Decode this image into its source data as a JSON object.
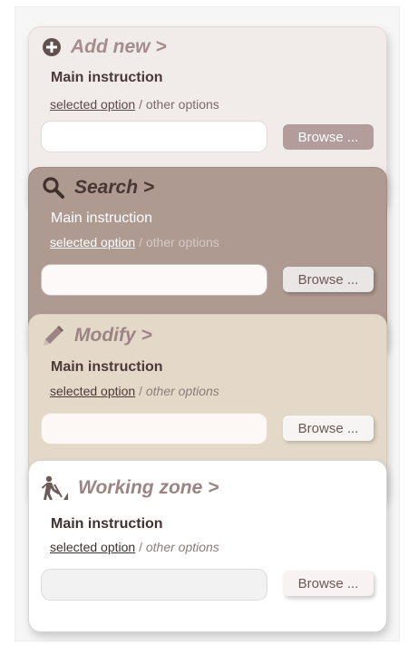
{
  "panels": {
    "add_new": {
      "title": "Add new >",
      "icon": "plus-circle-icon",
      "instruction": "Main instruction",
      "selected_option": "selected option",
      "other_options": " / other options",
      "input_value": "",
      "browse_label": "Browse ..."
    },
    "search": {
      "title": "Search >",
      "icon": "magnifier-icon",
      "instruction": "Main instruction",
      "selected_option": "selected option",
      "other_options": " / other options",
      "input_value": "",
      "browse_label": "Browse ..."
    },
    "modify": {
      "title": "Modify >",
      "icon": "pencil-icon",
      "instruction": "Main instruction",
      "selected_option": "selected option",
      "other_options": "other options",
      "separator": " / ",
      "input_value": "",
      "browse_label": "Browse ..."
    },
    "working_zone": {
      "title": "Working zone >",
      "icon": "construction-worker-icon",
      "instruction": "Main instruction",
      "selected_option": "selected option",
      "other_options": "other options",
      "separator": " / ",
      "input_value": "",
      "browse_label": "Browse ..."
    }
  },
  "colors": {
    "add_new_bg": "#f1ebea",
    "search_bg": "#ae9a91",
    "modify_bg": "#e4d9c8",
    "working_zone_bg": "#ffffff",
    "title_accent": "#a58d8d"
  }
}
